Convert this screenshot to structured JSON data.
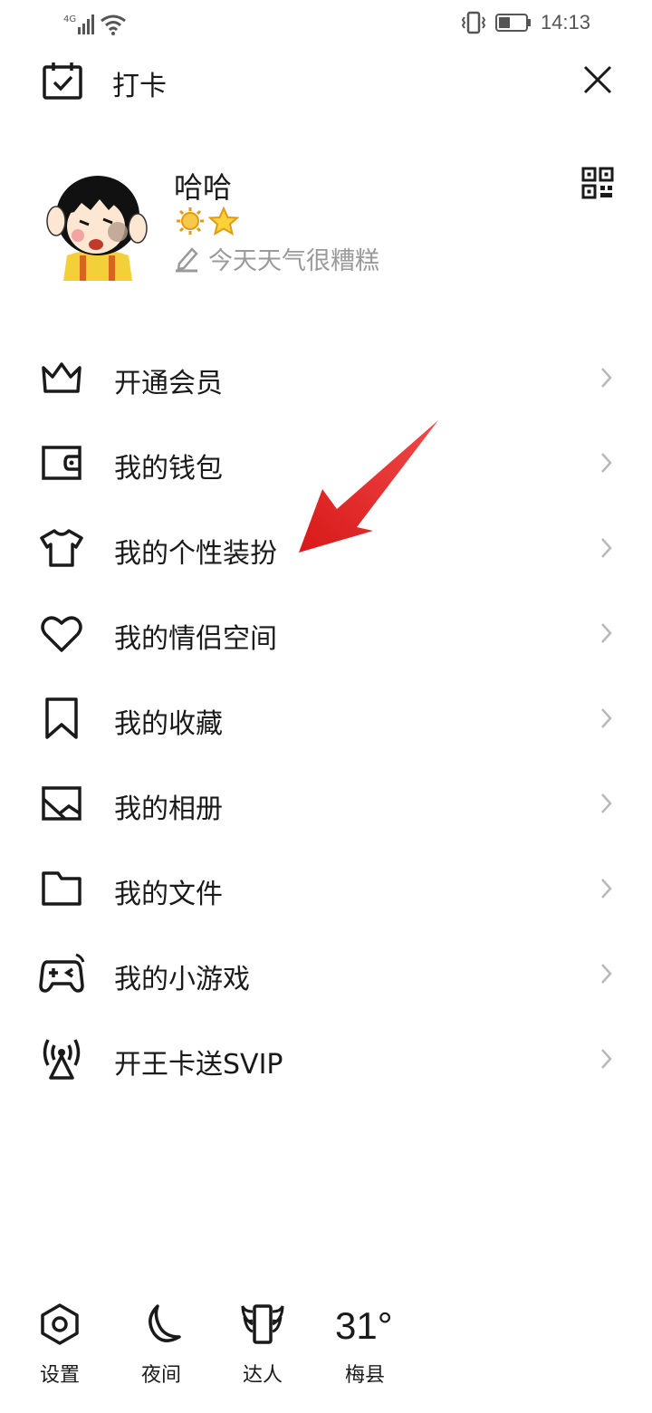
{
  "status_bar": {
    "network": "4G",
    "time": "14:13"
  },
  "header": {
    "checkin_label": "打卡"
  },
  "profile": {
    "username": "哈哈",
    "signature": "今天天气很糟糕",
    "badges": [
      "sun-badge",
      "star-badge"
    ]
  },
  "menu": {
    "items": [
      {
        "label": "开通会员",
        "icon": "crown-icon"
      },
      {
        "label": "我的钱包",
        "icon": "wallet-icon"
      },
      {
        "label": "我的个性装扮",
        "icon": "tshirt-icon"
      },
      {
        "label": "我的情侣空间",
        "icon": "heart-icon"
      },
      {
        "label": "我的收藏",
        "icon": "bookmark-icon"
      },
      {
        "label": "我的相册",
        "icon": "photo-album-icon"
      },
      {
        "label": "我的文件",
        "icon": "folder-icon"
      },
      {
        "label": "我的小游戏",
        "icon": "gamepad-icon"
      },
      {
        "label": "开王卡送SVIP",
        "icon": "signal-tower-icon"
      }
    ]
  },
  "bottom_bar": {
    "settings_label": "设置",
    "night_label": "夜间",
    "talent_label": "达人",
    "temperature": "31°",
    "city": "梅县"
  },
  "colors": {
    "annotation_arrow": "#e02020",
    "text_primary": "#1a1a1a",
    "text_secondary": "#9a9a9a",
    "chevron": "#b8b8b8"
  }
}
